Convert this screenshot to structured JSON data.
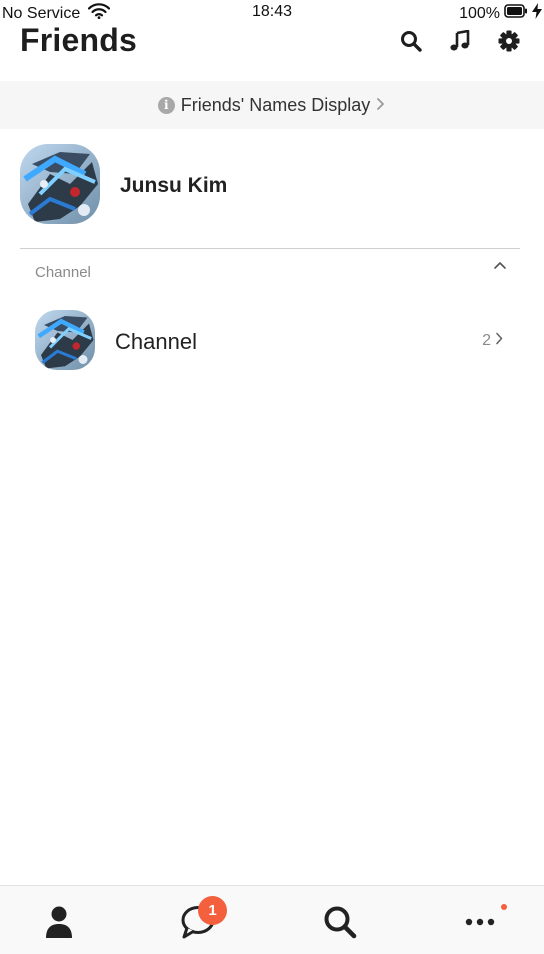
{
  "status_bar": {
    "carrier": "No Service",
    "time": "18:43",
    "battery": "100%"
  },
  "header": {
    "title": "Friends",
    "icons": [
      "search-icon",
      "music-icon",
      "gear-icon"
    ]
  },
  "banner": {
    "label": "Friends' Names Display"
  },
  "profile": {
    "name": "Junsu Kim"
  },
  "channel_section": {
    "label": "Channel",
    "items": [
      {
        "name": "Channel",
        "count": "2"
      }
    ]
  },
  "tabbar": {
    "tabs": [
      "person-icon",
      "chat-icon",
      "search-icon",
      "more-icon"
    ],
    "chat_badge": "1"
  },
  "colors": {
    "accent_badge": "#f45f3e",
    "banner_bg": "#f6f6f6",
    "text_primary": "#222222",
    "text_secondary": "#8a8a8a"
  }
}
